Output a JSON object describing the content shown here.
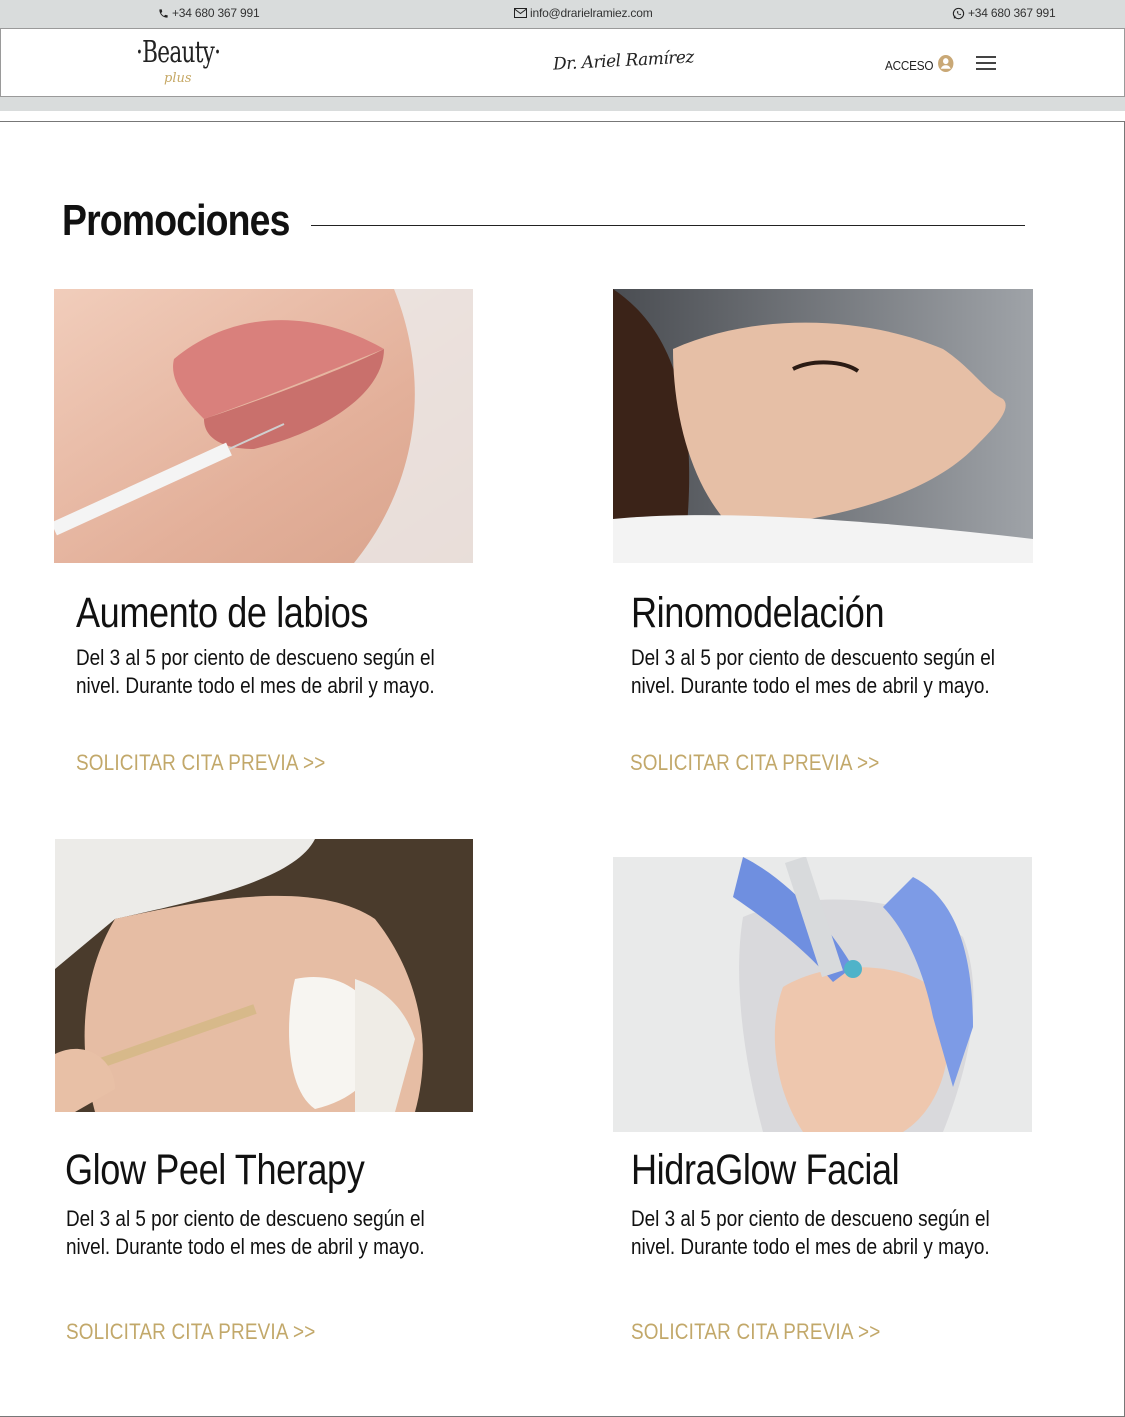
{
  "topbar": {
    "phone": "+34 680 367 991",
    "email": "info@drarielramiez.com",
    "whatsapp": "+34 680 367 991"
  },
  "header": {
    "logo_text": "·Beauty·",
    "logo_subtext": "plus",
    "signature": "Dr. Ariel Ramírez",
    "login_label": "ACCESO"
  },
  "main": {
    "title": "Promociones",
    "cards": [
      {
        "title": "Aumento de labios",
        "description": "Del 3 al 5 por ciento de descueno según el nivel. Durante todo el mes de abril y mayo.",
        "link": "SOLICITAR CITA PREVIA >>"
      },
      {
        "title": "Rinomodelación",
        "description": "Del 3 al 5 por ciento de descuento según el nivel. Durante todo el mes de abril y mayo.",
        "link": "SOLICITAR CITA PREVIA >>"
      },
      {
        "title": "Glow Peel Therapy",
        "description": "Del 3 al 5 por ciento de descueno según el nivel. Durante todo el mes de abril y mayo.",
        "link": "SOLICITAR CITA PREVIA >>"
      },
      {
        "title": "HidraGlow Facial",
        "description": "Del 3 al 5 por ciento de descueno según el nivel. Durante todo el mes de abril y mayo.",
        "link": "SOLICITAR CITA PREVIA >>"
      }
    ]
  },
  "colors": {
    "accent_gold": "#c2a86a",
    "topbar_bg": "#d9dcdc"
  },
  "icons": {
    "phone": "phone-icon",
    "email": "envelope-icon",
    "whatsapp": "whatsapp-icon",
    "user": "user-circle-icon",
    "menu": "hamburger-menu-icon"
  }
}
